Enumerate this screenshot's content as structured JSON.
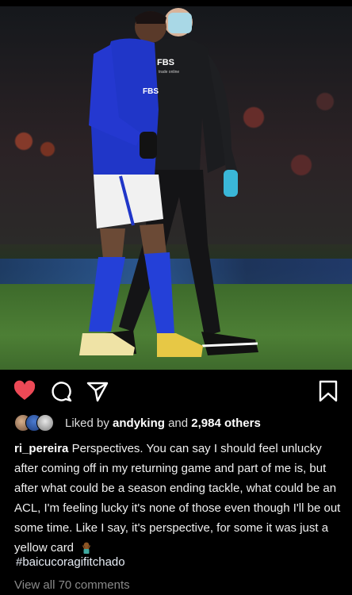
{
  "post": {
    "photo_alt": "",
    "username": "ri_pereira",
    "liked_by_prefix": "Liked by",
    "liked_by_user": "andyking",
    "liked_by_suffix": "and",
    "liked_by_count": "2,984 others",
    "caption": "Perspectives. You can say I should feel unlucky after coming off in my returning game and part of me is, but after what could be a season ending tackle, what could be an ACL, I'm feeling lucky it's none of those even though I'll be out some time. Like I say, it's perspective, for some it was just a yellow card",
    "hashtag": "#baicucoragifitchado",
    "view_comments": "View all 70 comments",
    "photo_text": {
      "shirt_sponsor": "FBS",
      "jacket_sponsor": "FBS",
      "jacket_sub": "trade online"
    }
  },
  "icons": {
    "like": "heart-filled-icon",
    "comment": "comment-bubble-icon",
    "share": "paper-plane-icon",
    "save": "bookmark-icon",
    "emoji": "person-shrugging-emoji"
  },
  "colors": {
    "like_red": "#ed4956",
    "background": "#000000",
    "text_secondary": "#8a8a8a"
  }
}
